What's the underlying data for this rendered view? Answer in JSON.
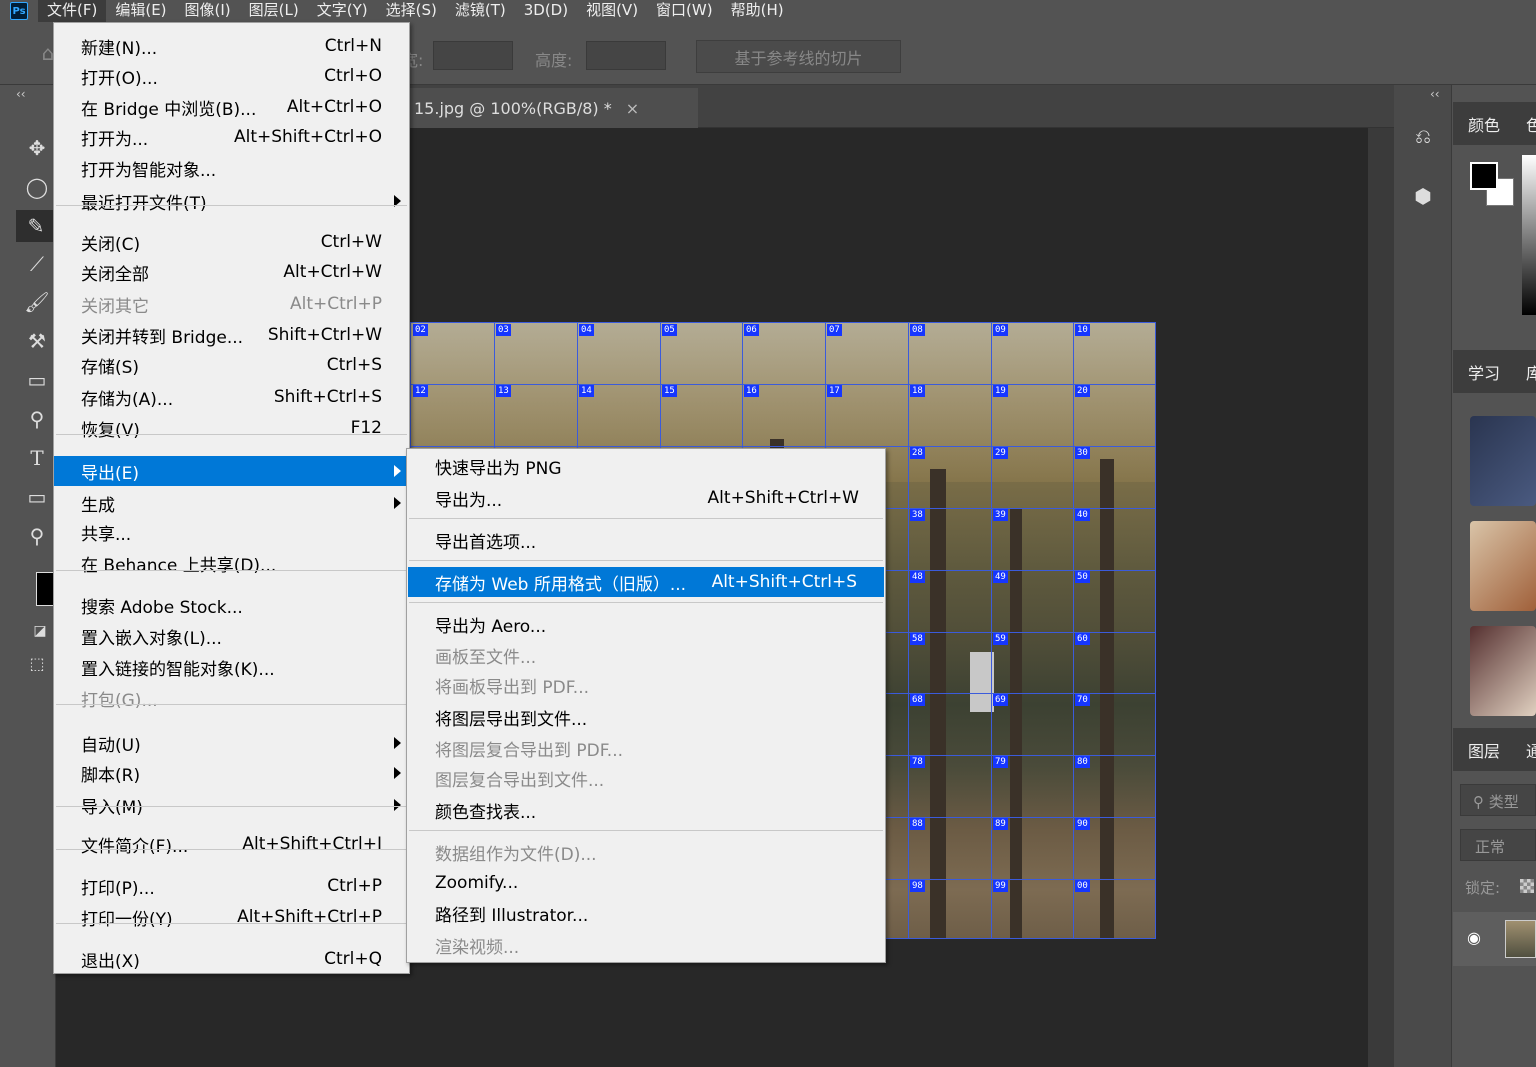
{
  "menubar": {
    "logo": "Ps",
    "items": [
      "文件(F)",
      "编辑(E)",
      "图像(I)",
      "图层(L)",
      "文字(Y)",
      "选择(S)",
      "滤镜(T)",
      "3D(D)",
      "视图(V)",
      "窗口(W)",
      "帮助(H)"
    ]
  },
  "options": {
    "width_label": "宽:",
    "height_label": "高度:",
    "slice_button": "基于参考线的切片"
  },
  "document": {
    "tab_title": "15.jpg @ 100%(RGB/8) *",
    "close": "×"
  },
  "panels": {
    "collapse": "‹‹",
    "color_tab": "颜色",
    "color_tab2": "色",
    "learn_tab": "学习",
    "learn_tab2": "库",
    "layers_tab": "图层",
    "layers_tab2": "通",
    "filter_kind": "类型",
    "blend_mode": "正常",
    "lock_label": "锁定:"
  },
  "file_menu": {
    "items": [
      {
        "label": "新建(N)...",
        "shortcut": "Ctrl+N"
      },
      {
        "label": "打开(O)...",
        "shortcut": "Ctrl+O"
      },
      {
        "label": "在 Bridge 中浏览(B)...",
        "shortcut": "Alt+Ctrl+O"
      },
      {
        "label": "打开为...",
        "shortcut": "Alt+Shift+Ctrl+O"
      },
      {
        "label": "打开为智能对象...",
        "shortcut": ""
      },
      {
        "label": "最近打开文件(T)",
        "shortcut": ""
      },
      {
        "label": "关闭(C)",
        "shortcut": "Ctrl+W"
      },
      {
        "label": "关闭全部",
        "shortcut": "Alt+Ctrl+W"
      },
      {
        "label": "关闭其它",
        "shortcut": "Alt+Ctrl+P"
      },
      {
        "label": "关闭并转到 Bridge...",
        "shortcut": "Shift+Ctrl+W"
      },
      {
        "label": "存储(S)",
        "shortcut": "Ctrl+S"
      },
      {
        "label": "存储为(A)...",
        "shortcut": "Shift+Ctrl+S"
      },
      {
        "label": "恢复(V)",
        "shortcut": "F12"
      },
      {
        "label": "导出(E)",
        "shortcut": ""
      },
      {
        "label": "生成",
        "shortcut": ""
      },
      {
        "label": "共享...",
        "shortcut": ""
      },
      {
        "label": "在 Behance 上共享(D)...",
        "shortcut": ""
      },
      {
        "label": "搜索 Adobe Stock...",
        "shortcut": ""
      },
      {
        "label": "置入嵌入对象(L)...",
        "shortcut": ""
      },
      {
        "label": "置入链接的智能对象(K)...",
        "shortcut": ""
      },
      {
        "label": "打包(G)...",
        "shortcut": ""
      },
      {
        "label": "自动(U)",
        "shortcut": ""
      },
      {
        "label": "脚本(R)",
        "shortcut": ""
      },
      {
        "label": "导入(M)",
        "shortcut": ""
      },
      {
        "label": "文件简介(F)...",
        "shortcut": "Alt+Shift+Ctrl+I"
      },
      {
        "label": "打印(P)...",
        "shortcut": "Ctrl+P"
      },
      {
        "label": "打印一份(Y)",
        "shortcut": "Alt+Shift+Ctrl+P"
      },
      {
        "label": "退出(X)",
        "shortcut": "Ctrl+Q"
      }
    ]
  },
  "export_menu": {
    "items": [
      {
        "label": "快速导出为 PNG",
        "shortcut": ""
      },
      {
        "label": "导出为...",
        "shortcut": "Alt+Shift+Ctrl+W"
      },
      {
        "label": "导出首选项...",
        "shortcut": ""
      },
      {
        "label": "存储为 Web 所用格式（旧版）...",
        "shortcut": "Alt+Shift+Ctrl+S"
      },
      {
        "label": "导出为 Aero...",
        "shortcut": ""
      },
      {
        "label": "画板至文件...",
        "shortcut": ""
      },
      {
        "label": "将画板导出到 PDF...",
        "shortcut": ""
      },
      {
        "label": "将图层导出到文件...",
        "shortcut": ""
      },
      {
        "label": "将图层复合导出到 PDF...",
        "shortcut": ""
      },
      {
        "label": "图层复合导出到文件...",
        "shortcut": ""
      },
      {
        "label": "颜色查找表...",
        "shortcut": ""
      },
      {
        "label": "数据组作为文件(D)...",
        "shortcut": ""
      },
      {
        "label": "Zoomify...",
        "shortcut": ""
      },
      {
        "label": "路径到 Illustrator...",
        "shortcut": ""
      },
      {
        "label": "渲染视频...",
        "shortcut": ""
      }
    ]
  },
  "slices": {
    "labels": [
      "02",
      "03",
      "04",
      "05",
      "06",
      "07",
      "08",
      "09",
      "10",
      "12",
      "13",
      "14",
      "15",
      "16",
      "17",
      "18",
      "19",
      "20",
      "28",
      "29",
      "30",
      "38",
      "39",
      "40",
      "48",
      "49",
      "50",
      "58",
      "59",
      "60",
      "68",
      "69",
      "70",
      "78",
      "79",
      "80",
      "88",
      "89",
      "90",
      "98",
      "99",
      "00"
    ]
  },
  "colors": {
    "highlight": "#0078d7",
    "slice_line": "#3b5bdb",
    "slice_label": "#1636ff"
  }
}
